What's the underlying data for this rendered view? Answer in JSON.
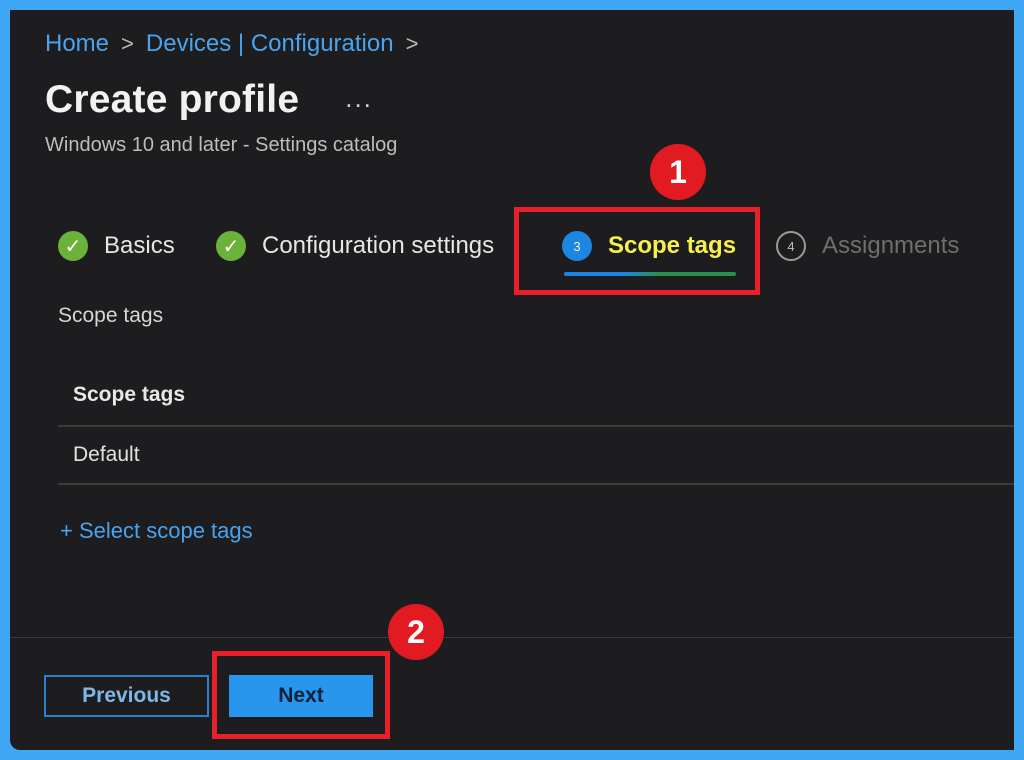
{
  "breadcrumb": {
    "home": "Home",
    "devices": "Devices | Configuration",
    "separator": ">"
  },
  "header": {
    "title": "Create profile",
    "more": "...",
    "subtitle": "Windows 10 and later - Settings catalog"
  },
  "steps": [
    {
      "label": "Basics",
      "state": "completed",
      "marker": "✓"
    },
    {
      "label": "Configuration settings",
      "state": "completed",
      "marker": "✓"
    },
    {
      "label": "Scope tags",
      "state": "active",
      "marker": "3"
    },
    {
      "label": "Assignments",
      "state": "upcoming",
      "marker": "4"
    }
  ],
  "section": {
    "label": "Scope tags"
  },
  "table": {
    "header": "Scope tags",
    "rows": [
      "Default"
    ]
  },
  "select_link": "+ Select scope tags",
  "footer": {
    "previous_label": "Previous",
    "next_label": "Next"
  },
  "annotations": {
    "badge_1": "1",
    "badge_2": "2"
  },
  "colors": {
    "accent": "#2796ec",
    "active_step_text": "#f7f04a",
    "completed": "#6bb13a",
    "highlight": "#e8202a"
  }
}
